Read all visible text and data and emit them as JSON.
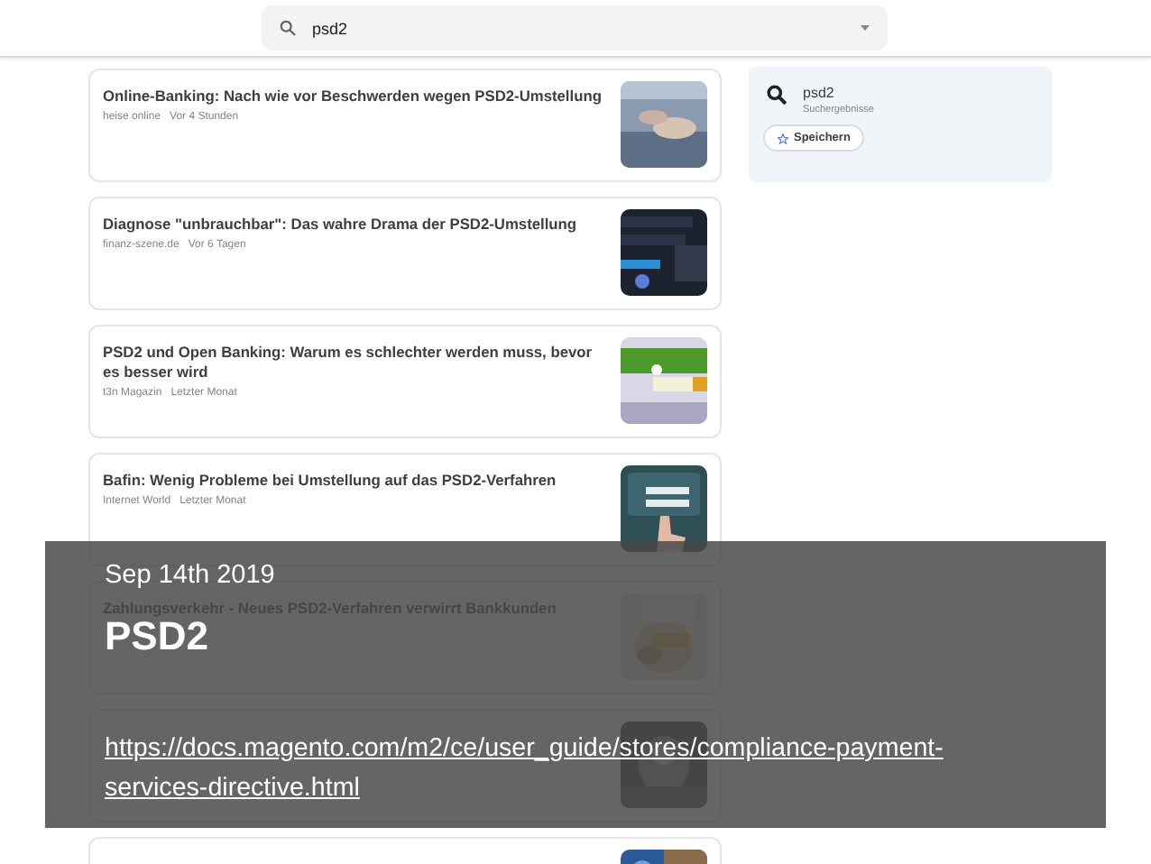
{
  "search": {
    "value": "psd2"
  },
  "articles": [
    {
      "title": "Online-Banking: Nach wie vor Beschwerden wegen PSD2-Umstellung",
      "source": "heise online",
      "time": "Vor 4 Stunden",
      "image": {
        "kind": "picture"
      }
    },
    {
      "title": "Diagnose \"unbrauchbar\": Das wahre Drama der PSD2-Umstellung",
      "source": "finanz-szene.de",
      "time": "Vor 6 Tagen",
      "image": {
        "kind": "picture"
      }
    },
    {
      "title": "PSD2 und Open Banking: Warum es schlechter werden muss, bevor es besser wird",
      "source": "t3n Magazin",
      "time": "Letzter Monat",
      "image": {
        "kind": "picture"
      }
    },
    {
      "title": "Bafin: Wenig Probleme bei Umstellung auf das PSD2-Verfahren",
      "source": "Internet World",
      "time": "Letzter Monat",
      "image": {
        "kind": "picture"
      }
    },
    {
      "title": "Zahlungsverkehr - Neues PSD2-Verfahren verwirrt Bankkunden",
      "image": {
        "kind": "picture"
      }
    },
    {
      "image": {
        "kind": "picture"
      }
    },
    {
      "image": {
        "kind": "picture"
      }
    }
  ],
  "panel": {
    "query": "psd2",
    "subtitle": "Suchergebnisse",
    "save_button": "Speichern"
  },
  "caption": {
    "date": "Sep 14th 2019",
    "title": "PSD2",
    "link": "https://docs.magento.com/m2/ce/user_guide/stores/compliance-payment-services-directive.html"
  }
}
